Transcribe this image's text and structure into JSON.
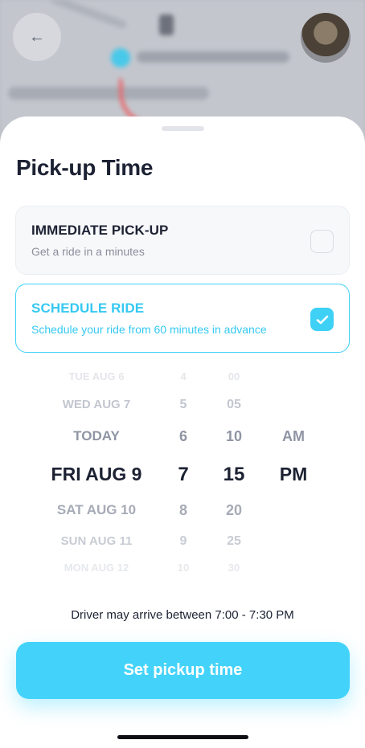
{
  "sheet": {
    "title": "Pick-up Time"
  },
  "options": [
    {
      "title": "IMMEDIATE PICK-UP",
      "subtitle": "Get a ride in a minutes",
      "selected": false
    },
    {
      "title": "SCHEDULE RIDE",
      "subtitle": "Schedule your ride from 60 minutes in advance",
      "selected": true
    }
  ],
  "picker": {
    "dates": [
      "TUE AUG 6",
      "WED AUG 7",
      "TODAY",
      "FRI AUG 9",
      "SAT AUG 10",
      "SUN AUG 11",
      "MON AUG 12"
    ],
    "hours": [
      "4",
      "5",
      "6",
      "7",
      "8",
      "9",
      "10"
    ],
    "minutes": [
      "00",
      "05",
      "10",
      "15",
      "20",
      "25",
      "30"
    ],
    "ampm": [
      "AM",
      "PM"
    ],
    "selected": {
      "date": "FRI AUG 9",
      "hour": "7",
      "minute": "15",
      "ampm": "PM"
    }
  },
  "note": "Driver may arrive between 7:00 - 7:30 PM",
  "cta": {
    "label": "Set pickup time"
  },
  "colors": {
    "accent": "#43d3fa",
    "text": "#1c2233",
    "muted": "#8a8f9c"
  }
}
